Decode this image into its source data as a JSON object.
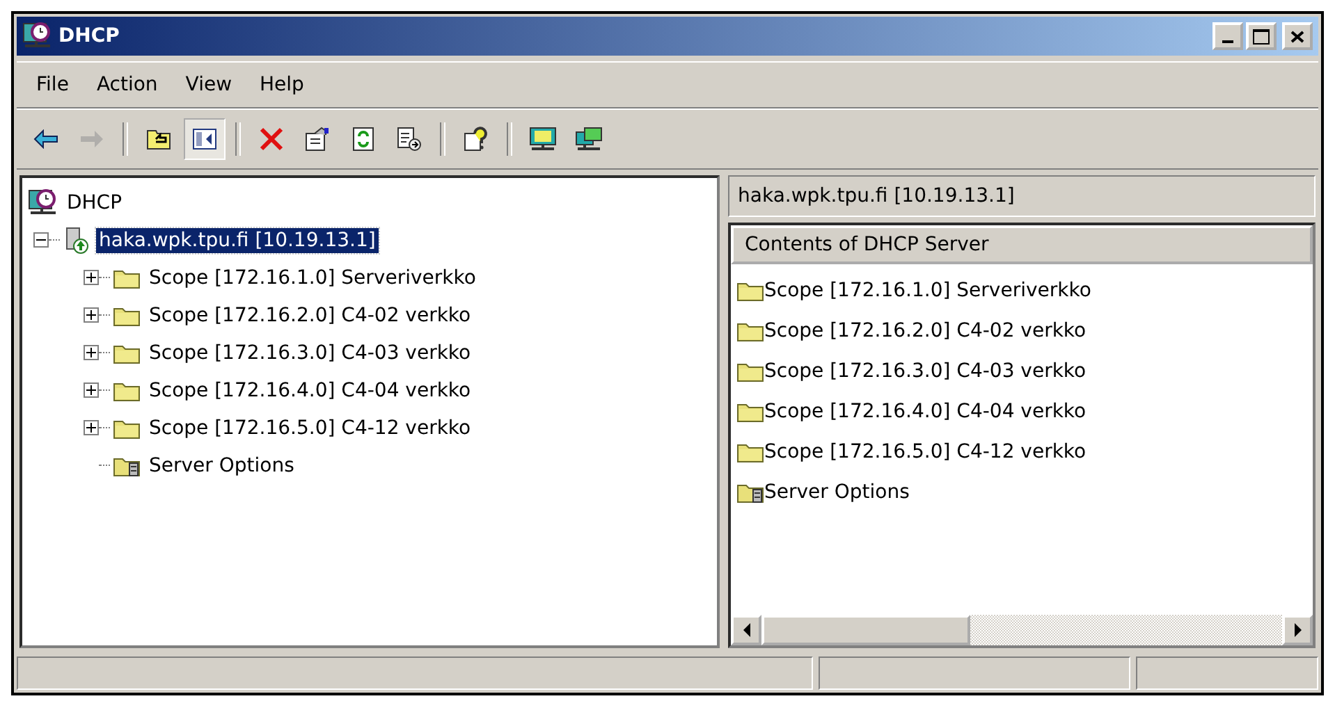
{
  "window": {
    "title": "DHCP"
  },
  "menu": [
    {
      "label": "File"
    },
    {
      "label": "Action"
    },
    {
      "label": "View"
    },
    {
      "label": "Help"
    }
  ],
  "toolbar": [
    {
      "kind": "back",
      "selected": false,
      "disabled": false
    },
    {
      "kind": "forward",
      "selected": false,
      "disabled": true
    },
    {
      "kind": "sep"
    },
    {
      "kind": "up",
      "selected": false,
      "disabled": false
    },
    {
      "kind": "tree",
      "selected": true,
      "disabled": false
    },
    {
      "kind": "sep"
    },
    {
      "kind": "delete",
      "selected": false,
      "disabled": false
    },
    {
      "kind": "properties",
      "selected": false,
      "disabled": false
    },
    {
      "kind": "refresh",
      "selected": false,
      "disabled": false
    },
    {
      "kind": "export",
      "selected": false,
      "disabled": false
    },
    {
      "kind": "sep"
    },
    {
      "kind": "help",
      "selected": false,
      "disabled": false
    },
    {
      "kind": "sep"
    },
    {
      "kind": "monitor",
      "selected": false,
      "disabled": false
    },
    {
      "kind": "monitor2",
      "selected": false,
      "disabled": false
    }
  ],
  "tree": [
    {
      "label": "DHCP",
      "kind": "root",
      "selected": false,
      "children": [
        {
          "label": "haka.wpk.tpu.fi [10.19.13.1]",
          "kind": "server",
          "selected": true,
          "expanded": true,
          "children": [
            {
              "label": "Scope [172.16.1.0] Serveriverkko",
              "kind": "folder",
              "selected": false,
              "expanded": false
            },
            {
              "label": "Scope [172.16.2.0] C4-02 verkko",
              "kind": "folder",
              "selected": false,
              "expanded": false
            },
            {
              "label": "Scope [172.16.3.0] C4-03 verkko",
              "kind": "folder",
              "selected": false,
              "expanded": false
            },
            {
              "label": "Scope [172.16.4.0] C4-04 verkko",
              "kind": "folder",
              "selected": false,
              "expanded": false
            },
            {
              "label": "Scope [172.16.5.0] C4-12 verkko",
              "kind": "folder",
              "selected": false,
              "expanded": false
            },
            {
              "label": "Server Options",
              "kind": "options",
              "selected": false
            }
          ]
        }
      ]
    }
  ],
  "details": {
    "path": "haka.wpk.tpu.fi [10.19.13.1]",
    "column": "Contents of DHCP Server",
    "items": [
      {
        "label": "Scope [172.16.1.0] Serveriverkko",
        "kind": "folder"
      },
      {
        "label": "Scope [172.16.2.0] C4-02 verkko",
        "kind": "folder"
      },
      {
        "label": "Scope [172.16.3.0] C4-03 verkko",
        "kind": "folder"
      },
      {
        "label": "Scope [172.16.4.0] C4-04 verkko",
        "kind": "folder"
      },
      {
        "label": "Scope [172.16.5.0] C4-12 verkko",
        "kind": "folder"
      },
      {
        "label": "Server Options",
        "kind": "options"
      }
    ]
  }
}
